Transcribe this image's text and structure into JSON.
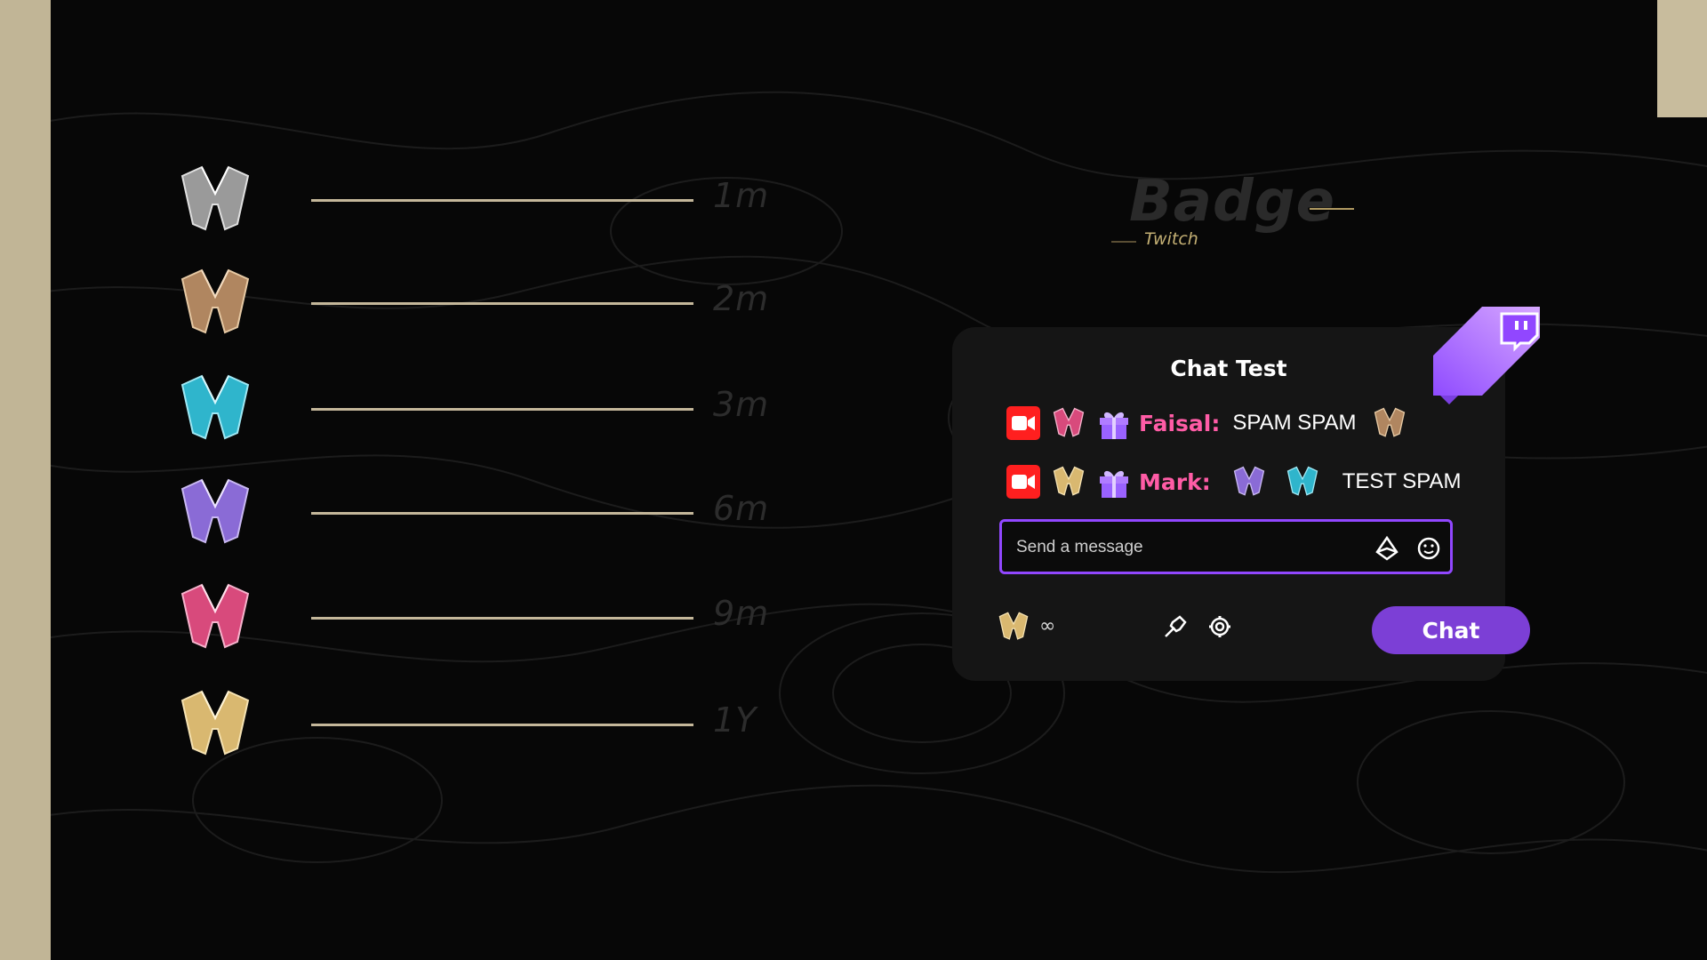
{
  "colors": {
    "page_frame": "#c1b596",
    "background": "#070707",
    "gold_rule": "#c4b79a",
    "username": "#ff5ca6",
    "twitch_purple": "#9147ff",
    "chat_button": "#7c3fd6"
  },
  "tiers": [
    {
      "duration": "1m",
      "badge_color": "silver"
    },
    {
      "duration": "2m",
      "badge_color": "bronze"
    },
    {
      "duration": "3m",
      "badge_color": "cyan"
    },
    {
      "duration": "6m",
      "badge_color": "purple"
    },
    {
      "duration": "9m",
      "badge_color": "pink"
    },
    {
      "duration": "1Y",
      "badge_color": "gold"
    }
  ],
  "header": {
    "title": "Badge",
    "subtitle": "Twitch"
  },
  "chat": {
    "title": "Chat Test",
    "messages": [
      {
        "icons": [
          "camera-icon",
          "pink-badge-icon",
          "gift-icon"
        ],
        "username": "Faisal:",
        "text": "SPAM SPAM",
        "trailing_icon": "bronze-badge-icon"
      },
      {
        "icons": [
          "camera-icon",
          "gold-badge-icon",
          "gift-icon"
        ],
        "username": "Mark:",
        "emotes": [
          "purple-badge-icon",
          "cyan-badge-icon"
        ],
        "text": "TEST SPAM"
      }
    ],
    "input_placeholder": "Send a message",
    "points_value": "∞",
    "button_label": "Chat"
  }
}
